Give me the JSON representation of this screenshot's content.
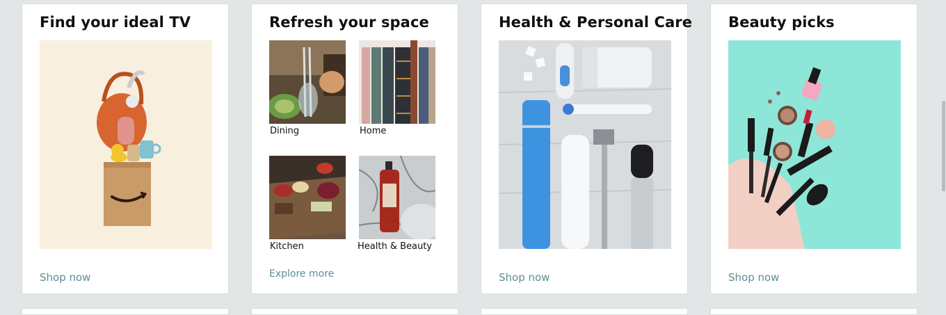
{
  "cards": [
    {
      "title": "Find your ideal TV",
      "link": "Shop now",
      "image": "amazon-box-with-bag-and-gadgets"
    },
    {
      "title": "Refresh your space",
      "link": "Explore more",
      "tiles": [
        {
          "label": "Dining",
          "image": "dining-table-glassware"
        },
        {
          "label": "Home",
          "image": "hanging-clothes-organizer"
        },
        {
          "label": "Kitchen",
          "image": "charcuterie-board"
        },
        {
          "label": "Health & Beauty",
          "image": "shampoo-bottle-on-marble"
        }
      ]
    },
    {
      "title": "Health & Personal Care",
      "link": "Shop now",
      "image": "toothbrush-razor-deodorant-flatlay"
    },
    {
      "title": "Beauty picks",
      "link": "Shop now",
      "image": "makeup-brushes-and-cosmetics"
    }
  ],
  "colors": {
    "page_background": "#e3e6e6",
    "card_background": "#ffffff",
    "title_text": "#0f1111",
    "link_text": "#5a8f97"
  }
}
